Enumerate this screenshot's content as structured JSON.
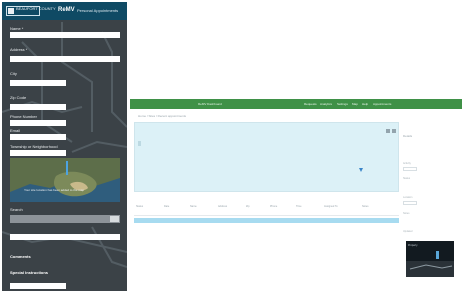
{
  "mobile": {
    "logo_text": "BEAUFORT COUNTY",
    "app_title": "ReMV",
    "app_subtitle": "Personal Appointments",
    "fields": [
      {
        "label": "Name *",
        "value": ""
      },
      {
        "label": "Address *",
        "value": ""
      },
      {
        "label": "City",
        "value": ""
      },
      {
        "label": "Zip Code",
        "value": ""
      },
      {
        "label": "Phone Number",
        "value": ""
      },
      {
        "label": "Email",
        "value": ""
      },
      {
        "label": "Township or Neighborhood",
        "value": ""
      }
    ],
    "map_caption": "Your site location has been added to the map",
    "search_label": "Search",
    "footer_labels": [
      "Comments",
      "Special Instructions"
    ],
    "colors": {
      "header": "#0f4a64",
      "background": "#3b4247"
    }
  },
  "desktop": {
    "brand": "ReMV Dashboard",
    "nav": [
      "Requests",
      "Analytics",
      "Settings",
      "Map",
      "Help",
      "Appointments"
    ],
    "breadcrumbs": "Home   /   Sites   /   Recent appointments",
    "table_headers": [
      "Status",
      "Date",
      "Name",
      "Address",
      "Zip",
      "Phone",
      "Time",
      "Assigned To",
      "Notes"
    ],
    "side_title": "Details",
    "side_items": [
      "Activity",
      "Status",
      "Location",
      "Notes",
      "Updated"
    ],
    "thumb_text": "Property",
    "colors": {
      "nav": "#3f9147",
      "map_bg": "#dcf1f7",
      "selected_row": "#a7dbf0"
    }
  }
}
